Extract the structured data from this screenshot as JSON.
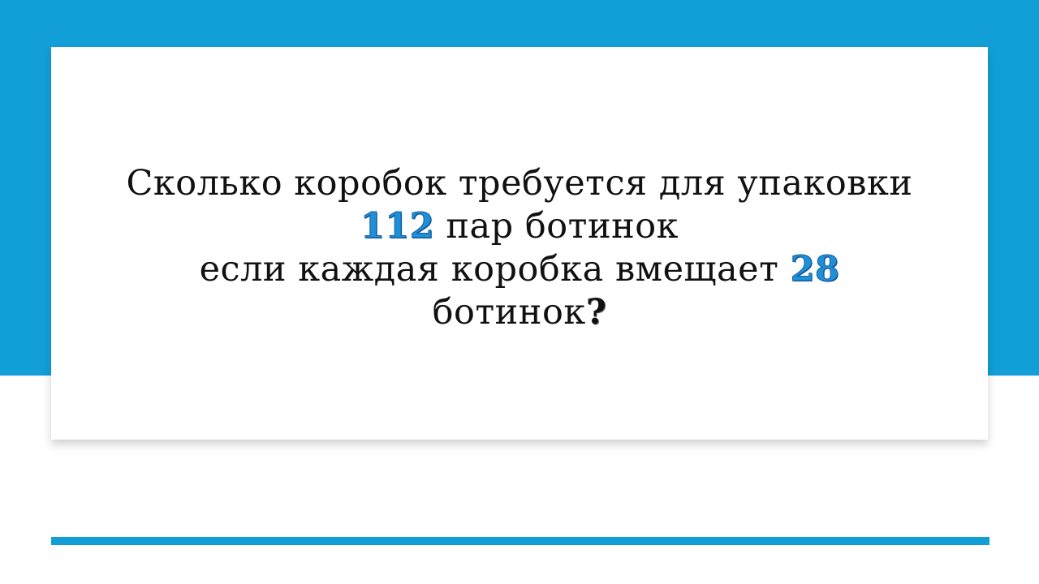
{
  "slide": {
    "question": {
      "line1": "Сколько коробок требуется для упаковки",
      "line2_number": "112",
      "line2_text": " пар ботинок",
      "line3_text": "если каждая коробка вмещает ",
      "line3_number": "28",
      "line4_text": "ботинок",
      "line4_mark": "?"
    }
  },
  "colors": {
    "accent": "#129fd7",
    "number": "#1f8fd6",
    "text": "#111111",
    "background": "#ffffff"
  }
}
